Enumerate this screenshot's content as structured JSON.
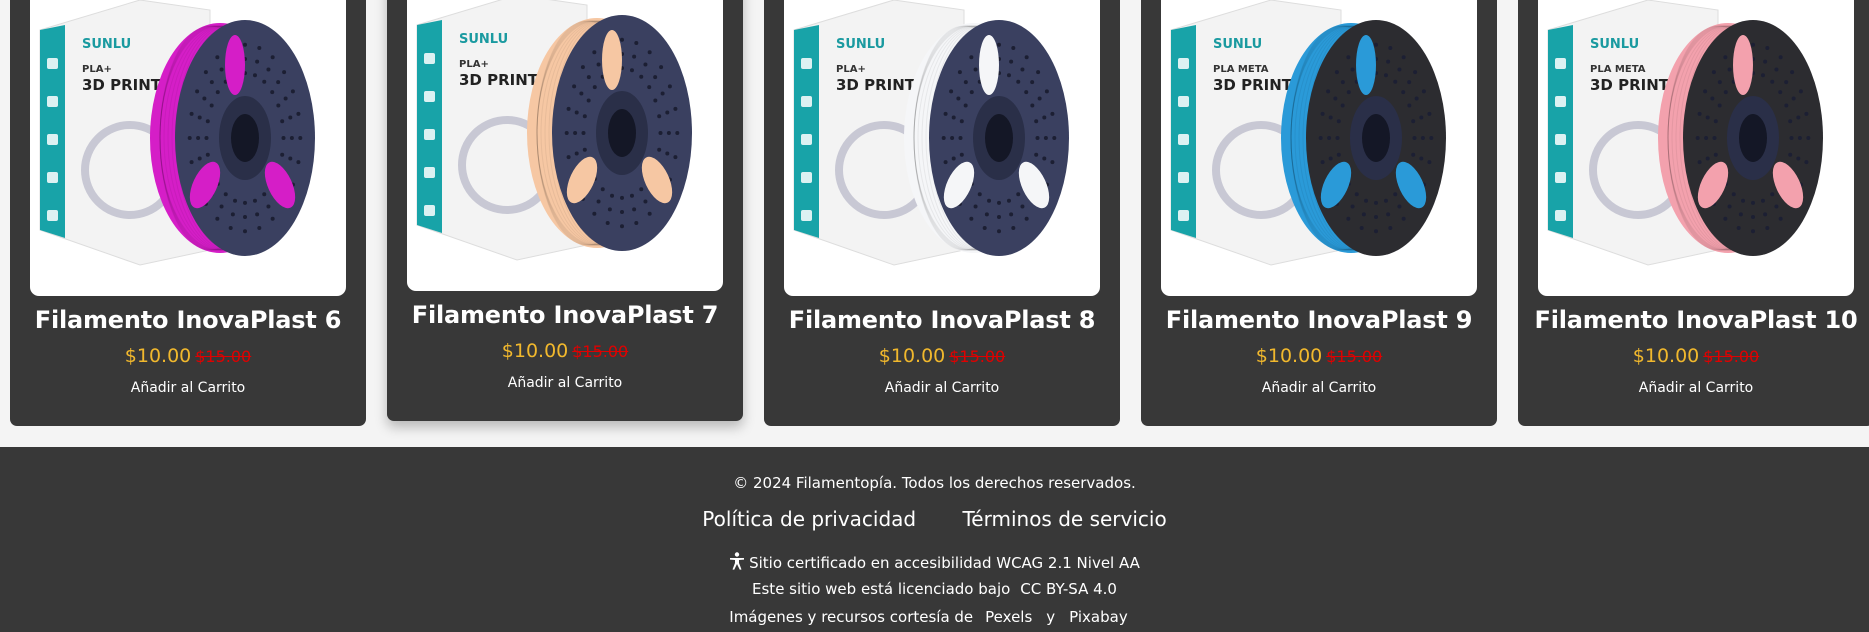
{
  "products": [
    {
      "title": "Filamento InovaPlast 6",
      "price": "$10.00",
      "old_price": "$15.00",
      "add_label": "Añadir al Carrito",
      "brand": "SUNLU",
      "box_text": "PLA+",
      "box_sub": "3D PRINTIN",
      "spool_color": "#d51ec7",
      "frame_color": "#3a4060",
      "raised": false
    },
    {
      "title": "Filamento InovaPlast 7",
      "price": "$10.00",
      "old_price": "$15.00",
      "add_label": "Añadir al Carrito",
      "brand": "SUNLU",
      "box_text": "PLA+",
      "box_sub": "3D PRINTIN",
      "spool_color": "#f6c7a3",
      "frame_color": "#3a4060",
      "raised": true
    },
    {
      "title": "Filamento InovaPlast 8",
      "price": "$10.00",
      "old_price": "$15.00",
      "add_label": "Añadir al Carrito",
      "brand": "SUNLU",
      "box_text": "PLA+",
      "box_sub": "3D PRINTIN",
      "spool_color": "#f5f6f8",
      "frame_color": "#3a4060",
      "raised": false
    },
    {
      "title": "Filamento InovaPlast 9",
      "price": "$10.00",
      "old_price": "$15.00",
      "add_label": "Añadir al Carrito",
      "brand": "SUNLU",
      "box_text": "PLA META",
      "box_sub": "3D PRINT",
      "spool_color": "#2a9ad8",
      "frame_color": "#2c2c30",
      "raised": false
    },
    {
      "title": "Filamento InovaPlast 10",
      "price": "$10.00",
      "old_price": "$15.00",
      "add_label": "Añadir al Carrito",
      "brand": "SUNLU",
      "box_text": "PLA META",
      "box_sub": "3D PRINT",
      "spool_color": "#f3a1ad",
      "frame_color": "#2c2c30",
      "raised": false
    }
  ],
  "footer": {
    "copyright": "© 2024 Filamentopía. Todos los derechos reservados.",
    "privacy": "Política de privacidad",
    "terms": "Términos de servicio",
    "accessibility": "Sitio certificado en accesibilidad WCAG 2.1 Nivel AA",
    "license_text": "Este sitio web está licenciado bajo",
    "license_link": "CC BY-SA 4.0",
    "credits_text": "Imágenes y recursos cortesía de",
    "credit_1": "Pexels",
    "credit_and": "y",
    "credit_2": "Pixabay"
  }
}
